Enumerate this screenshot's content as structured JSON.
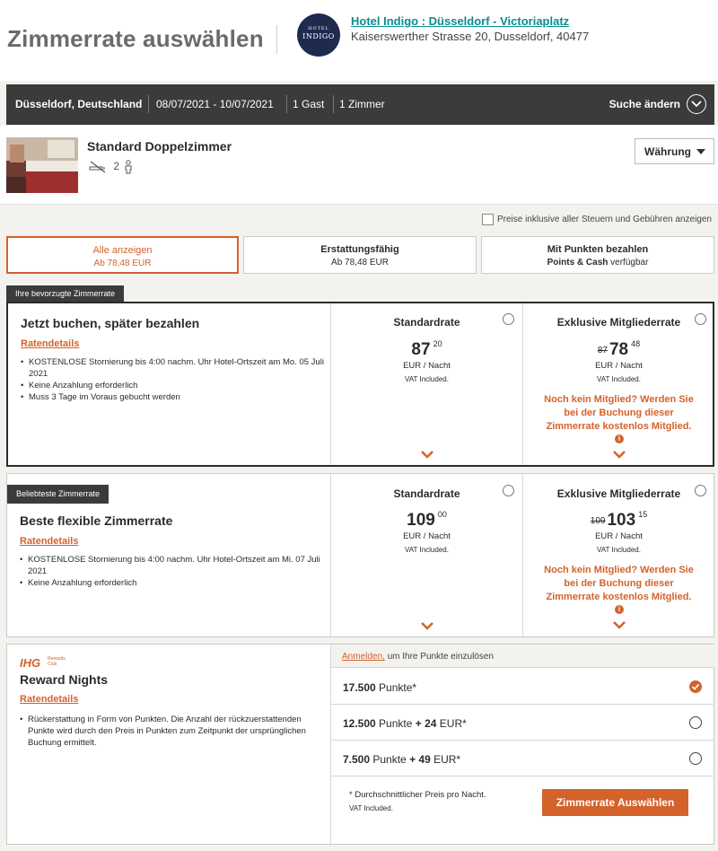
{
  "header": {
    "title": "Zimmerrate auswählen",
    "logo_top": "HOTEL",
    "logo_brand": "INDIGO",
    "hotel_name": "Hotel Indigo : Düsseldorf - Victoriaplatz",
    "hotel_address": "Kaiserswerther Strasse 20, Dusseldorf, 40477"
  },
  "search": {
    "location": "Düsseldorf, Deutschland",
    "dates": "08/07/2021 - 10/07/2021",
    "guests": "1 Gast",
    "rooms": "1 Zimmer",
    "change_label": "Suche ändern"
  },
  "room": {
    "name": "Standard Doppelzimmer",
    "occupancy": "2",
    "currency_label": "Währung"
  },
  "tax_toggle_label": "Preise inklusive aller Steuern und Gebühren anzeigen",
  "tabs": [
    {
      "label": "Alle anzeigen",
      "sub": "Ab 78,48 EUR"
    },
    {
      "label": "Erstattungsfähig",
      "sub": "Ab 78,48 EUR"
    },
    {
      "label": "Mit Punkten bezahlen",
      "sub_bold": "Points & Cash",
      "sub_rest": " verfügbar"
    }
  ],
  "rates": [
    {
      "flag": "Ihre bevorzugte Zimmerrate",
      "title": "Jetzt buchen, später bezahlen",
      "details_link": "Ratendetails",
      "bullets": [
        "KOSTENLOSE Stornierung bis 4:00 nachm. Uhr Hotel-Ortszeit am Mo. 05 Juli 2021",
        "Keine Anzahlung erforderlich",
        "Muss 3 Tage im Voraus gebucht werden"
      ],
      "standard": {
        "label": "Standardrate",
        "price": "87",
        "cents": "20",
        "unit": "EUR / Nacht",
        "vat": "VAT Included."
      },
      "member": {
        "label": "Exklusive Mitgliederrate",
        "old_price": "87",
        "price": "78",
        "cents": "48",
        "unit": "EUR / Nacht",
        "vat": "VAT Included.",
        "promo": "Noch kein Mitglied? Werden Sie bei der Buchung dieser Zimmerrate kostenlos Mitglied."
      }
    },
    {
      "flag": "Beliebteste Zimmerrate",
      "title": "Beste flexible Zimmerrate",
      "details_link": "Ratendetails",
      "bullets": [
        "KOSTENLOSE Stornierung bis 4:00 nachm. Uhr Hotel-Ortszeit am Mi. 07 Juli 2021",
        "Keine Anzahlung erforderlich"
      ],
      "standard": {
        "label": "Standardrate",
        "price": "109",
        "cents": "00",
        "unit": "EUR / Nacht",
        "vat": "VAT Included."
      },
      "member": {
        "label": "Exklusive Mitgliederrate",
        "old_price": "109",
        "price": "103",
        "cents": "15",
        "unit": "EUR / Nacht",
        "vat": "VAT Included.",
        "promo": "Noch kein Mitglied? Werden Sie bei der Buchung dieser Zimmerrate kostenlos Mitglied."
      }
    }
  ],
  "reward": {
    "brand": "IHG",
    "brand_sub1": "Rewards",
    "brand_sub2": "Club",
    "title": "Reward Nights",
    "details_link": "Ratendetails",
    "bullet": "Rückerstattung in Form von Punkten. Die Anzahl der rückzuerstattenden Punkte wird durch den Preis in Punkten zum Zeitpunkt der ursprünglichen Buchung ermittelt.",
    "signin_link": "Anmelden,",
    "signin_rest": " um Ihre Punkte einzulösen",
    "options": [
      {
        "points": "17.500",
        "points_word": " Punkte*",
        "plus": "",
        "cash": ""
      },
      {
        "points": "12.500",
        "points_word": " Punkte ",
        "plus": "+ 24",
        "cash": " EUR*"
      },
      {
        "points": "7.500",
        "points_word": " Punkte ",
        "plus": "+ 49",
        "cash": " EUR*"
      }
    ],
    "note": "*  Durchschnittlicher Preis pro Nacht.",
    "vat": "VAT Included.",
    "cta": "Zimmerrate Auswählen"
  },
  "colors": {
    "accent": "#d4622b",
    "dark_bar": "#3b3b3b",
    "teal_link": "#0c8c8c"
  }
}
